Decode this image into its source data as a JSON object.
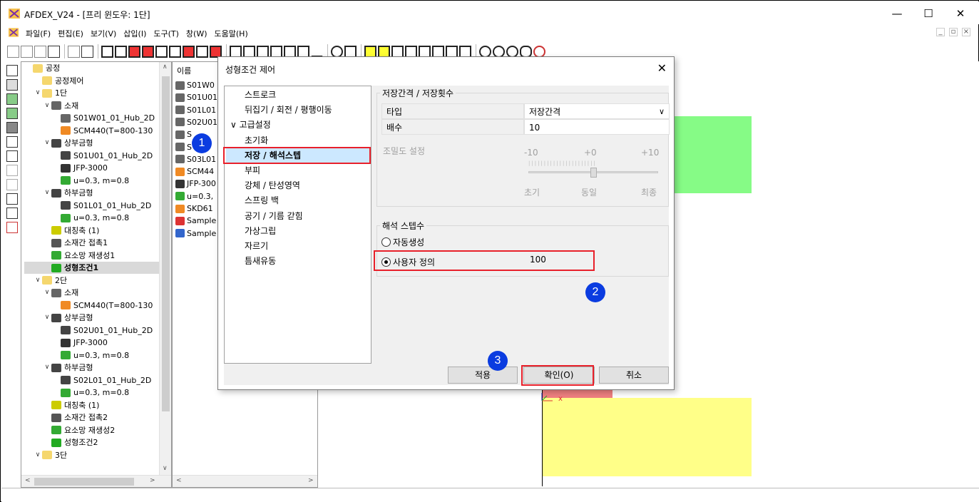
{
  "window": {
    "title": "AFDEX_V24 - [프리 윈도우: 1단]",
    "minimize": "—",
    "maximize": "☐",
    "close": "✕"
  },
  "menu": [
    "파일(F)",
    "편집(E)",
    "보기(V)",
    "삽입(I)",
    "도구(T)",
    "창(W)",
    "도움말(H)"
  ],
  "tree": [
    {
      "label": "공정",
      "indent": 0,
      "exp": "",
      "icon": "#f5d76e"
    },
    {
      "label": "공정제어",
      "indent": 1,
      "exp": "",
      "icon": "#f5d76e"
    },
    {
      "label": "1단",
      "indent": 1,
      "exp": "∨",
      "icon": "#f5d76e"
    },
    {
      "label": "소재",
      "indent": 2,
      "exp": "∨",
      "icon": "#666"
    },
    {
      "label": "S01W01_01_Hub_2D",
      "indent": 3,
      "exp": "",
      "icon": "#666"
    },
    {
      "label": "SCM440(T=800-130",
      "indent": 3,
      "exp": "",
      "icon": "#f08a24"
    },
    {
      "label": "상부금형",
      "indent": 2,
      "exp": "∨",
      "icon": "#444"
    },
    {
      "label": "S01U01_01_Hub_2D",
      "indent": 3,
      "exp": "",
      "icon": "#444"
    },
    {
      "label": "JFP-3000",
      "indent": 3,
      "exp": "",
      "icon": "#333"
    },
    {
      "label": "u=0.3, m=0.8",
      "indent": 3,
      "exp": "",
      "icon": "#3a3"
    },
    {
      "label": "하부금형",
      "indent": 2,
      "exp": "∨",
      "icon": "#444"
    },
    {
      "label": "S01L01_01_Hub_2D",
      "indent": 3,
      "exp": "",
      "icon": "#444"
    },
    {
      "label": "u=0.3, m=0.8",
      "indent": 3,
      "exp": "",
      "icon": "#3a3"
    },
    {
      "label": "대칭축 (1)",
      "indent": 2,
      "exp": "",
      "icon": "#cc0"
    },
    {
      "label": "소재간 접촉1",
      "indent": 2,
      "exp": "",
      "icon": "#555"
    },
    {
      "label": "요소망 재생성1",
      "indent": 2,
      "exp": "",
      "icon": "#3a3"
    },
    {
      "label": "성형조건1",
      "indent": 2,
      "exp": "",
      "icon": "#2a2",
      "selected": true
    },
    {
      "label": "2단",
      "indent": 1,
      "exp": "∨",
      "icon": "#f5d76e"
    },
    {
      "label": "소재",
      "indent": 2,
      "exp": "∨",
      "icon": "#666"
    },
    {
      "label": "SCM440(T=800-130",
      "indent": 3,
      "exp": "",
      "icon": "#f08a24"
    },
    {
      "label": "상부금형",
      "indent": 2,
      "exp": "∨",
      "icon": "#444"
    },
    {
      "label": "S02U01_01_Hub_2D",
      "indent": 3,
      "exp": "",
      "icon": "#444"
    },
    {
      "label": "JFP-3000",
      "indent": 3,
      "exp": "",
      "icon": "#333"
    },
    {
      "label": "u=0.3, m=0.8",
      "indent": 3,
      "exp": "",
      "icon": "#3a3"
    },
    {
      "label": "하부금형",
      "indent": 2,
      "exp": "∨",
      "icon": "#444"
    },
    {
      "label": "S02L01_01_Hub_2D",
      "indent": 3,
      "exp": "",
      "icon": "#444"
    },
    {
      "label": "u=0.3, m=0.8",
      "indent": 3,
      "exp": "",
      "icon": "#3a3"
    },
    {
      "label": "대칭축 (1)",
      "indent": 2,
      "exp": "",
      "icon": "#cc0"
    },
    {
      "label": "소재간 접촉2",
      "indent": 2,
      "exp": "",
      "icon": "#555"
    },
    {
      "label": "요소망 재생성2",
      "indent": 2,
      "exp": "",
      "icon": "#3a3"
    },
    {
      "label": "성형조건2",
      "indent": 2,
      "exp": "",
      "icon": "#2a2"
    },
    {
      "label": "3단",
      "indent": 1,
      "exp": "∨",
      "icon": "#f5d76e"
    }
  ],
  "list": {
    "header": "이름",
    "items": [
      {
        "label": "S01W0",
        "icon": "#666"
      },
      {
        "label": "S01U01",
        "icon": "#666"
      },
      {
        "label": "S01L01",
        "icon": "#666"
      },
      {
        "label": "S02U01",
        "icon": "#666"
      },
      {
        "label": "S",
        "icon": "#666"
      },
      {
        "label": "S",
        "icon": "#666"
      },
      {
        "label": "S03L01",
        "icon": "#666"
      },
      {
        "label": "SCM44",
        "icon": "#f08a24"
      },
      {
        "label": "JFP-300",
        "icon": "#333"
      },
      {
        "label": "u=0.3,",
        "icon": "#3a3"
      },
      {
        "label": "SKD61",
        "icon": "#f08a24"
      },
      {
        "label": "Sample",
        "icon": "#d33"
      },
      {
        "label": "Sample",
        "icon": "#36c"
      }
    ]
  },
  "dialog": {
    "title": "성형조건 제어",
    "close": "✕",
    "nav": [
      {
        "label": "스트로크",
        "indent": 0
      },
      {
        "label": "뒤집기 / 회전 / 평행이동",
        "indent": 0
      },
      {
        "label": "∨  고급설정",
        "indent": 0
      },
      {
        "label": "초기화",
        "indent": 1
      },
      {
        "label": "저장 / 해석스텝",
        "indent": 1,
        "selected": true
      },
      {
        "label": "부피",
        "indent": 1
      },
      {
        "label": "강체 / 탄성영역",
        "indent": 1
      },
      {
        "label": "스프링 백",
        "indent": 1
      },
      {
        "label": "공기 / 기름 갇힘",
        "indent": 1
      },
      {
        "label": "가상그립",
        "indent": 1
      },
      {
        "label": "자르기",
        "indent": 1
      },
      {
        "label": "틈새유동",
        "indent": 1
      }
    ],
    "save_group": {
      "label": "저장간격 / 저장횟수",
      "type_label": "타입",
      "type_value": "저장간격",
      "multiplier_label": "배수",
      "multiplier_value": "10",
      "density_label": "조밀도 설정",
      "slider_min": "-10",
      "slider_mid": "+0",
      "slider_max": "+10",
      "slider_value": 0,
      "early": "초기",
      "even": "동일",
      "final": "최종"
    },
    "steps_group": {
      "label": "해석 스텝수",
      "auto": "자동생성",
      "user": "사용자 정의",
      "user_value": "100"
    },
    "buttons": {
      "apply": "적용",
      "ok": "확인(O)",
      "cancel": "취소"
    }
  },
  "badges": [
    "1",
    "2",
    "3"
  ],
  "colors": {
    "highlight": "#e8202a",
    "badge": "#0b3ce0",
    "selection": "#cce8ff"
  }
}
